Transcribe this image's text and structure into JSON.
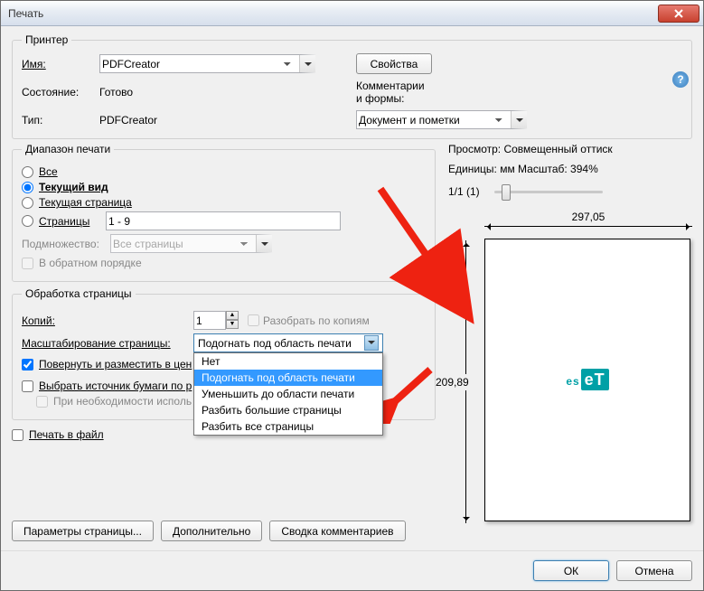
{
  "window": {
    "title": "Печать"
  },
  "printer": {
    "group": "Принтер",
    "name_label": "Имя:",
    "name_value": "PDFCreator",
    "properties_btn": "Свойства",
    "state_label": "Состояние:",
    "state_value": "Готово",
    "type_label": "Тип:",
    "type_value": "PDFCreator",
    "comments_label": "Комментарии и формы:",
    "comments_value": "Документ и пометки"
  },
  "range": {
    "group": "Диапазон печати",
    "all": "Все",
    "current_view": "Текущий вид",
    "current_page": "Текущая страница",
    "pages": "Страницы",
    "pages_value": "1 - 9",
    "subset_label": "Подмножество:",
    "subset_value": "Все страницы",
    "reverse": "В обратном порядке"
  },
  "handling": {
    "group": "Обработка страницы",
    "copies_label": "Копий:",
    "copies_value": "1",
    "collate": "Разобрать по копиям",
    "scaling_label": "Масштабирование страницы:",
    "scaling_value": "Подогнать под область печати",
    "scaling_options": [
      "Нет",
      "Подогнать под область печати",
      "Уменьшить до области печати",
      "Разбить большие страницы",
      "Разбить все страницы"
    ],
    "rotate": "Повернуть и разместить в цен",
    "paper_source": "Выбрать источник бумаги по р",
    "use_custom": "При необходимости исполь",
    "print_to_file": "Печать в файл"
  },
  "preview": {
    "header": "Просмотр: Совмещенный оттиск",
    "units": "Единицы: мм Масштаб: 394%",
    "pagecount": "1/1 (1)",
    "width": "297,05",
    "height": "209,89",
    "logo_text_a": "es",
    "logo_text_b": "eT"
  },
  "footer": {
    "page_setup": "Параметры страницы...",
    "advanced": "Дополнительно",
    "summary": "Сводка комментариев",
    "ok": "ОК",
    "cancel": "Отмена"
  }
}
